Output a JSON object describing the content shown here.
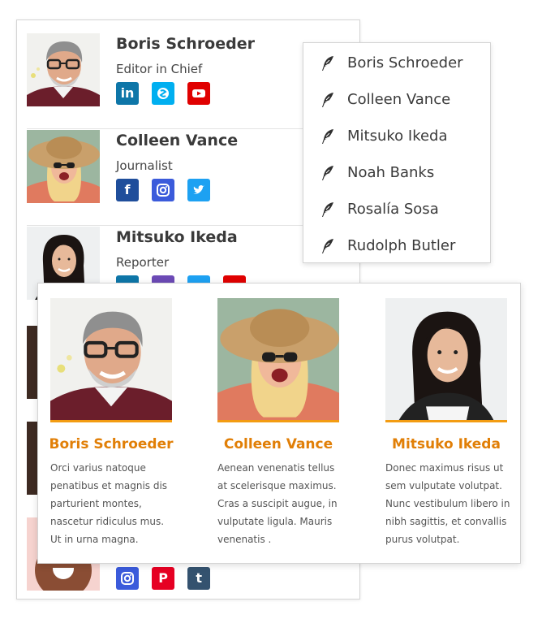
{
  "authors": [
    {
      "name": "Boris Schroeder",
      "role": "Editor in Chief",
      "socials": [
        "linkedin-icon",
        "skype-icon",
        "youtube-icon"
      ]
    },
    {
      "name": "Colleen Vance",
      "role": "Journalist",
      "socials": [
        "facebook-icon",
        "instagram-icon",
        "twitter-icon"
      ]
    },
    {
      "name": "Mitsuko Ikeda",
      "role": "Reporter",
      "socials": [
        "linkedin-icon",
        "purple-social-icon",
        "twitter-icon",
        "youtube-icon"
      ]
    }
  ],
  "last_author_socials": [
    "instagram-icon",
    "pinterest-icon",
    "tumblr-icon"
  ],
  "dropdown": {
    "items": [
      "Boris Schroeder",
      "Colleen Vance",
      "Mitsuko Ikeda",
      "Noah Banks",
      "Rosalía Sosa",
      "Rudolph Butler"
    ],
    "icon": "quill-feather-icon"
  },
  "cards": [
    {
      "name": "Boris Schroeder",
      "bio": "Orci varius natoque\npenatibus et magnis dis\nparturient montes,\nnascetur ridiculus mus.\nUt in urna magna."
    },
    {
      "name": "Colleen Vance",
      "bio": "Aenean venenatis tellus\nat scelerisque maximus.\nCras a suscipit augue, in\nvulputate ligula. Mauris\nvenenatis ."
    },
    {
      "name": "Mitsuko Ikeda",
      "bio": "Donec maximus risus ut\nsem vulputate volutpat.\nNunc vestibulum libero in\nnibh sagittis, et convallis\npurus volutpat."
    }
  ],
  "icon_glyphs": {
    "linkedin": "in",
    "facebook": "f",
    "tumblr": "t",
    "pinterest": "P"
  },
  "colors": {
    "accent_orange": "#e17f07",
    "card_bar": "#f39c12",
    "linkedin": "#0e76a8",
    "skype": "#00aff0",
    "youtube": "#e00000",
    "facebook": "#1f4e9b",
    "instagram": "#3b5bdb",
    "twitter": "#1da1f2",
    "pinterest": "#e60023",
    "tumblr": "#34526f"
  }
}
